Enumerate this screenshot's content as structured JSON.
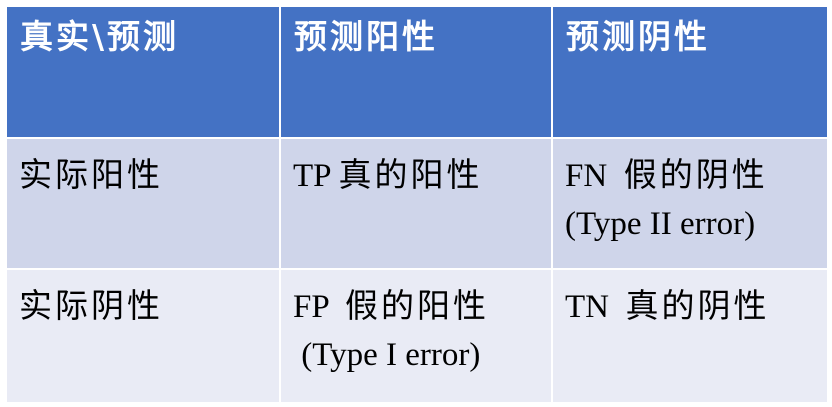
{
  "table": {
    "header": {
      "corner": "真实\\预测",
      "predicted_positive": "预测阳性",
      "predicted_negative": "预测阴性"
    },
    "rows": [
      {
        "label": "实际阳性",
        "cell_pos": {
          "code": "TP ",
          "text": "真的阳性",
          "note": ""
        },
        "cell_neg": {
          "code": "FN  ",
          "text": "假的阴性",
          "note": "(Type II error)"
        }
      },
      {
        "label": "实际阴性",
        "cell_pos": {
          "code": "FP  ",
          "text": "假的阳性",
          "note": " (Type I error)"
        },
        "cell_neg": {
          "code": "TN  ",
          "text": "真的阴性",
          "note": ""
        }
      }
    ]
  },
  "colors": {
    "header_bg": "#4472c4",
    "row1_bg": "#cfd5ea",
    "row2_bg": "#e9ebf5",
    "header_text": "#ffffff",
    "body_text": "#000000"
  }
}
